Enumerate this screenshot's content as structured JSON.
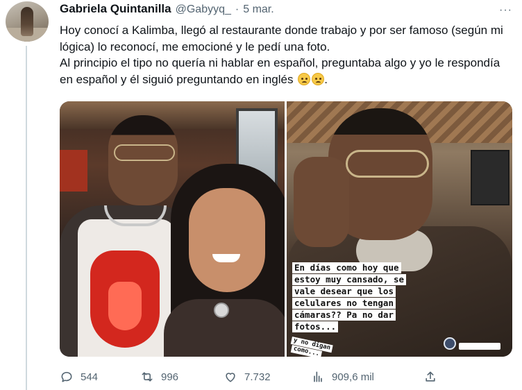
{
  "author": {
    "name": "Gabriela Quintanilla",
    "handle": "@Gabyyq_",
    "separator": "·",
    "date": "5 mar."
  },
  "more_icon": "···",
  "tweet": {
    "line1": "Hoy conocí a Kalimba, llegó al restaurante donde trabajo y por ser famoso (según mi lógica) lo reconocí, me emocioné y le pedí una foto.",
    "line2": "Al principio el tipo no quería ni hablar en español, preguntaba algo y yo le respondía en español y él siguió preguntando en inglés",
    "line2_end": "."
  },
  "media": {
    "sticker_lines": [
      "En días como hoy que",
      "estoy muy cansado, se",
      "vale desear que los",
      "celulares no tengan",
      "cámaras?? Pa no dar",
      "fotos..."
    ],
    "sticker_small": [
      "y no digan",
      "como..."
    ]
  },
  "actions": {
    "replies": "544",
    "retweets": "996",
    "likes": "7.732",
    "views": "909,6 mil"
  }
}
